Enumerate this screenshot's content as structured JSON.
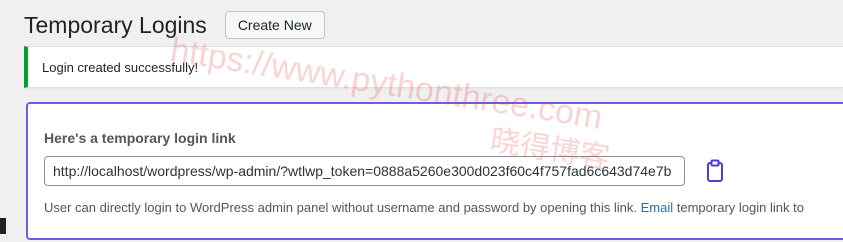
{
  "header": {
    "title": "Temporary Logins",
    "create_button": "Create New"
  },
  "notice": {
    "message": "Login created successfully!",
    "status_color": "#00a32a"
  },
  "link_panel": {
    "heading": "Here's a temporary login link",
    "url_value": "http://localhost/wordpress/wp-admin/?wtlwp_token=0888a5260e300d023f60c4f757fad6c643d74e7b",
    "copy_icon": "clipboard-icon",
    "help_text": "User can directly login to WordPress admin panel without username and password by opening this link. ",
    "help_link": "Email",
    "help_text_after": " temporary login link to",
    "border_color": "#6e5ce6",
    "accent_color": "#2271b1"
  },
  "watermark": {
    "url": "https://www.pythonthree.com",
    "name": "晓得博客"
  }
}
